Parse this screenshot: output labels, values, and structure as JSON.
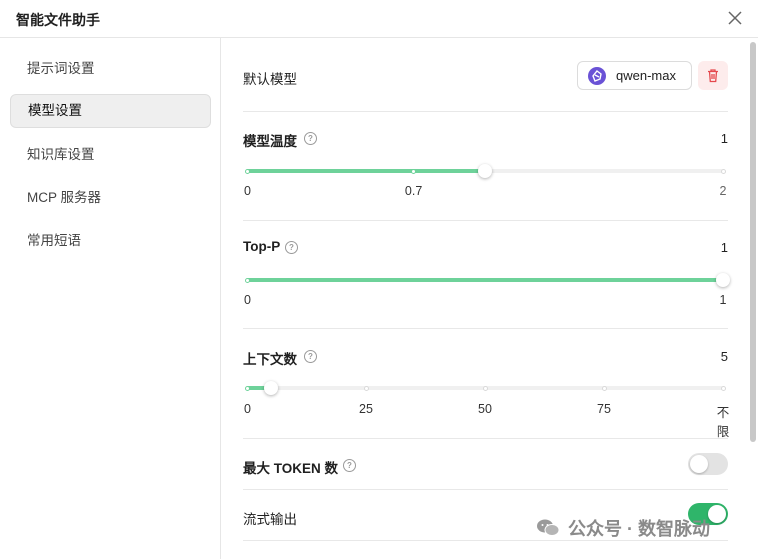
{
  "window": {
    "title": "智能文件助手"
  },
  "sidebar": {
    "items": [
      {
        "label": "提示词设置"
      },
      {
        "label": "模型设置",
        "active": true
      },
      {
        "label": "知识库设置"
      },
      {
        "label": "MCP 服务器"
      },
      {
        "label": "常用短语"
      }
    ]
  },
  "settings": {
    "default_model": {
      "label": "默认模型",
      "model_name": "qwen-max"
    },
    "temperature": {
      "label": "模型温度",
      "value_text": "1",
      "value": 1,
      "min": 0,
      "max": 2,
      "ticks": [
        "0",
        "0.7",
        "2"
      ],
      "tick_values": [
        0,
        0.7,
        2
      ]
    },
    "top_p": {
      "label": "Top-P",
      "value_text": "1",
      "value": 1,
      "min": 0,
      "max": 1,
      "ticks": [
        "0",
        "1"
      ],
      "tick_values": [
        0,
        1
      ]
    },
    "context_count": {
      "label": "上下文数",
      "value_text": "5",
      "value": 5,
      "min": 0,
      "max": 100,
      "ticks": [
        "0",
        "25",
        "50",
        "75",
        "不限"
      ],
      "tick_values": [
        0,
        25,
        50,
        75,
        100
      ]
    },
    "max_tokens": {
      "label": "最大 TOKEN 数",
      "enabled": false
    },
    "streaming": {
      "label": "流式输出",
      "enabled": true
    }
  },
  "watermark": {
    "text": "公众号 · 数智脉动"
  },
  "colors": {
    "accent": "#6ed29a",
    "toggle_on": "#2fb56a",
    "model_logo": "#6a52d6",
    "delete_bg": "#fdecec",
    "delete_icon": "#e5484d"
  }
}
